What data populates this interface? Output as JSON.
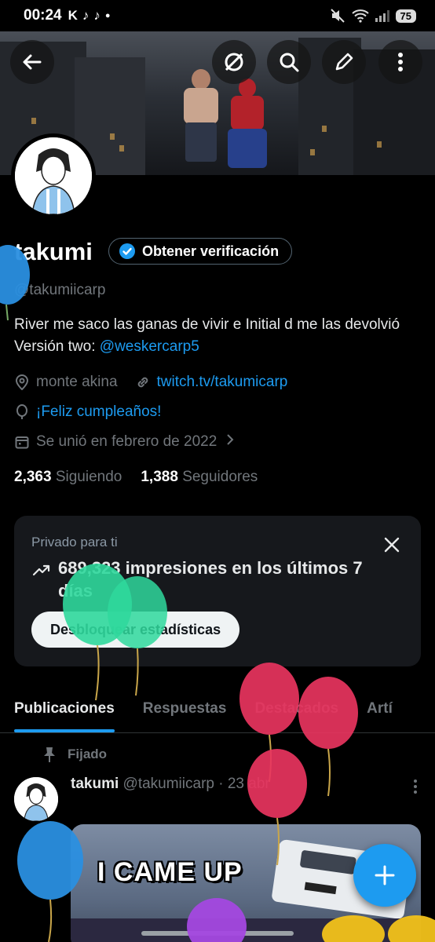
{
  "status_bar": {
    "time": "00:24",
    "battery": "75"
  },
  "profile": {
    "name": "takumi",
    "verify_button": "Obtener verificación",
    "handle": "@takumiicarp",
    "bio_text": "River me saco las ganas de vivir e Initial d me las devolvió  Versión two: ",
    "bio_mention": "@weskercarp5",
    "location": "monte akina",
    "website": "twitch.tv/takumicarp",
    "birthday": "¡Feliz cumpleaños!",
    "joined": "Se unió en febrero de 2022",
    "following_count": "2,363",
    "following_label": "Siguiendo",
    "followers_count": "1,388",
    "followers_label": "Seguidores"
  },
  "stats_card": {
    "private_label": "Privado para ti",
    "impressions_text": "689,323 impresiones en los últimos 7 días",
    "unlock_button": "Desbloquear estadísticas"
  },
  "tabs": [
    "Publicaciones",
    "Respuestas",
    "Destacados",
    "Artí"
  ],
  "pinned_post": {
    "pinned_label": "Fijado",
    "author": "takumi",
    "handle_date": "@takumiicarp · 23 abr",
    "media_caption": "I CAME UP"
  },
  "colors": {
    "accent": "#1d9bf0",
    "background": "#000000",
    "card": "#16181c"
  }
}
